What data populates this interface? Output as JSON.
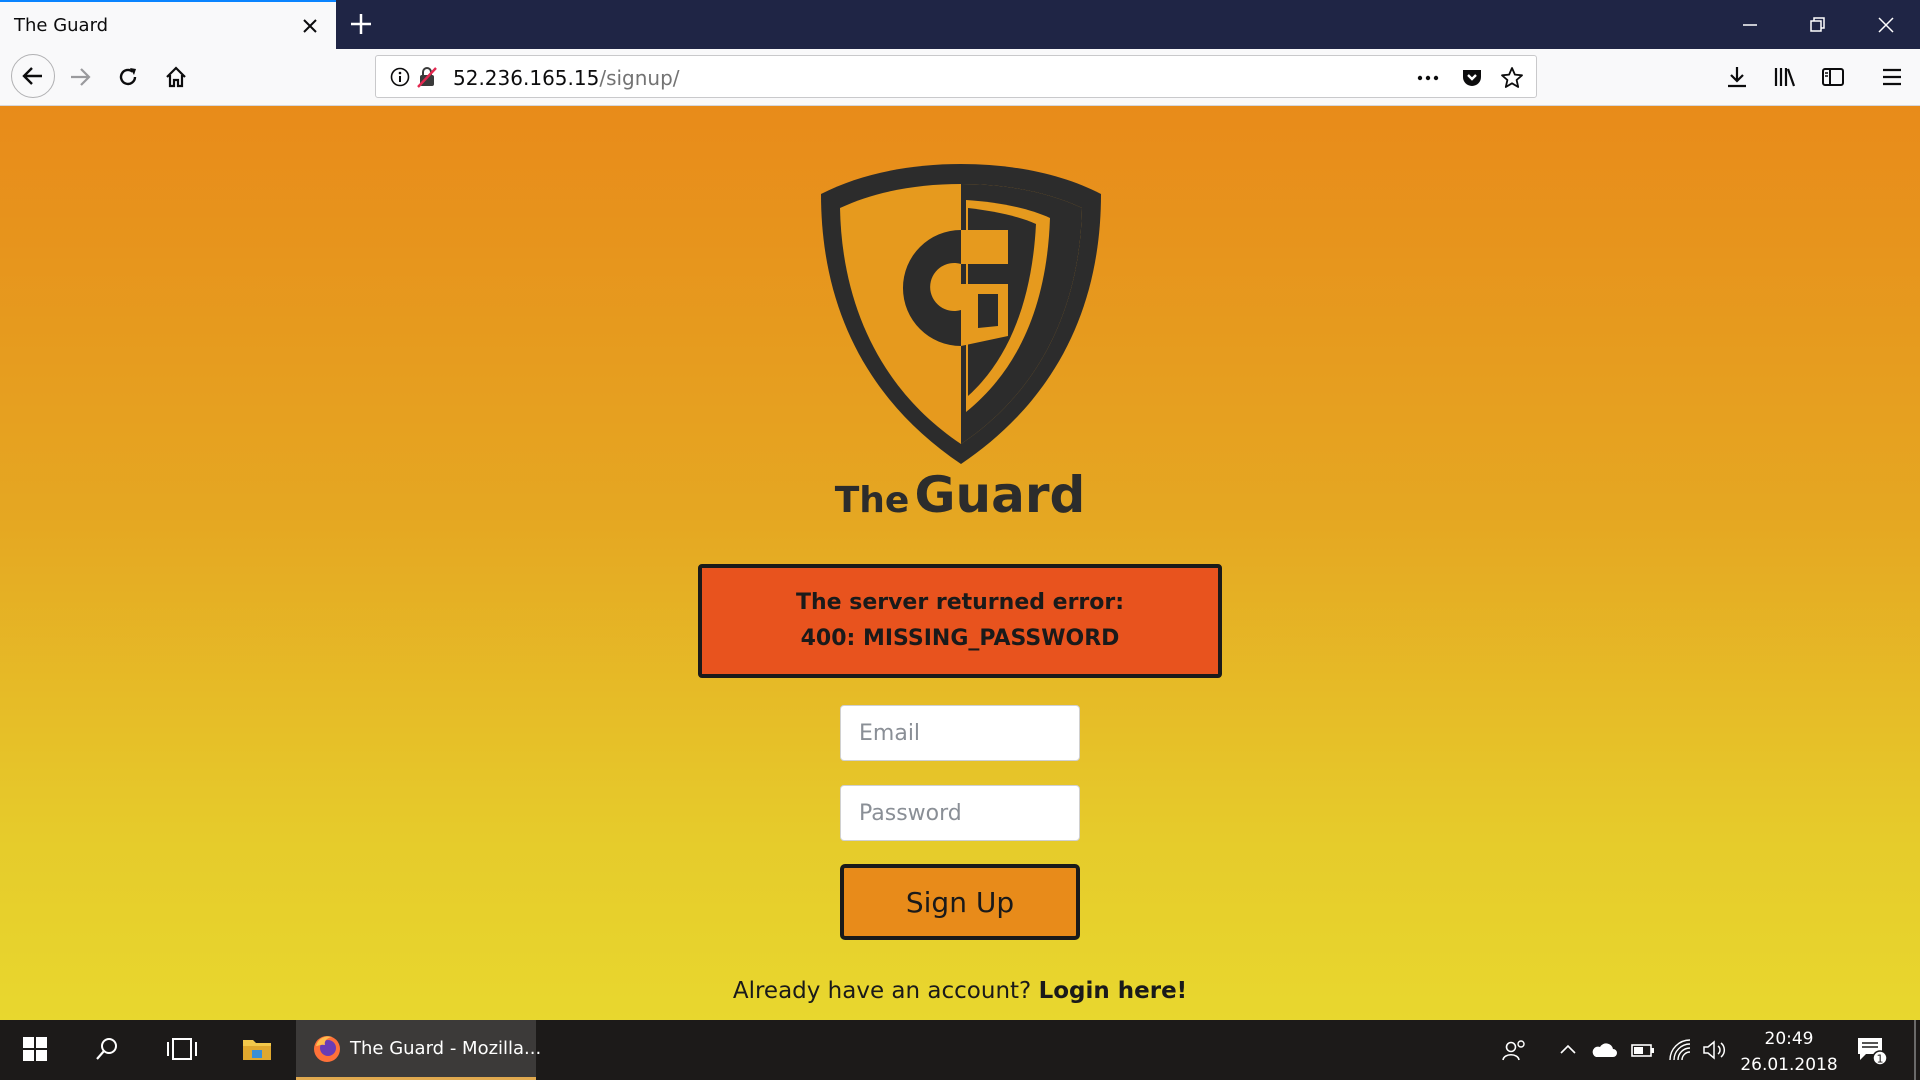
{
  "browser": {
    "tab_title": "The Guard",
    "url_host": "52.236.165.15",
    "url_path": "/signup/"
  },
  "page": {
    "brand_the": "The",
    "brand_guard": "Guard",
    "error_message": "The server returned error: 400: MISSING_PASSWORD",
    "email_placeholder": "Email",
    "password_placeholder": "Password",
    "signup_label": "Sign Up",
    "login_prompt": "Already have an account?",
    "login_link": "Login here!"
  },
  "taskbar": {
    "app_label": "The Guard - Mozilla...",
    "time": "20:49",
    "date": "26.01.2018",
    "notification_count": "1"
  },
  "colors": {
    "error_bg": "#e8531e",
    "button_bg": "#e88b1a",
    "gradient_top": "#e88b1a",
    "gradient_bottom": "#e8d72e",
    "logo": "#2c2c2c"
  }
}
